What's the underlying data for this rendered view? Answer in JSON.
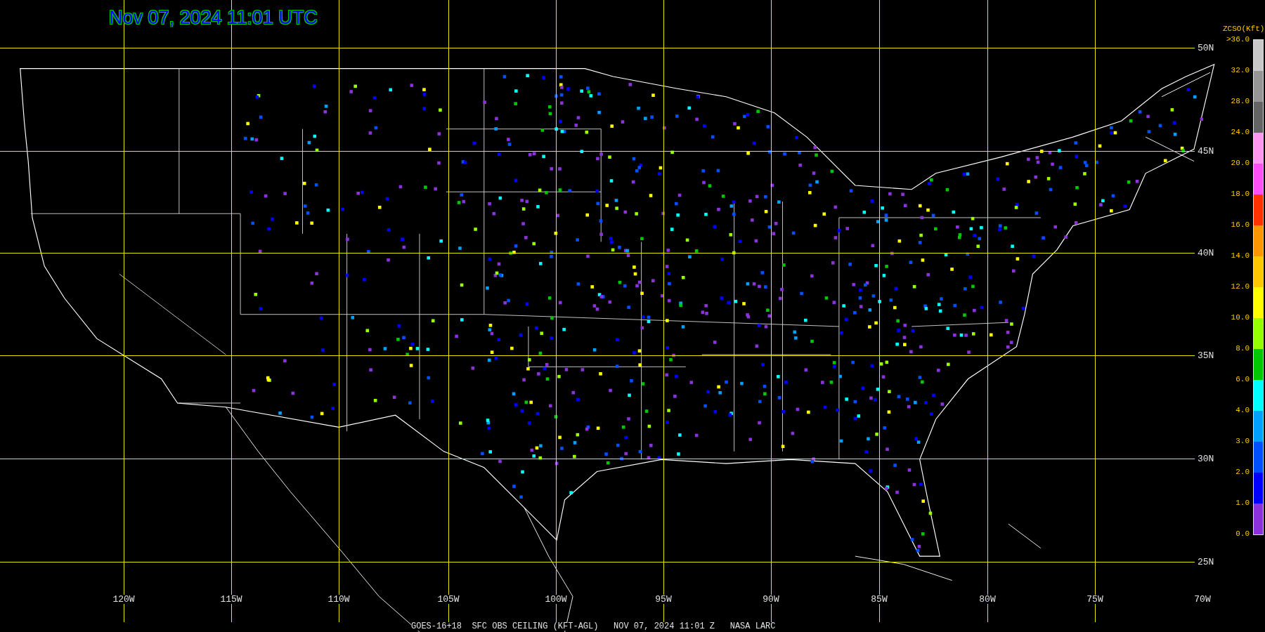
{
  "title": "Nov 07, 2024 11:01 UTC",
  "latitude_labels": [
    "50N",
    "45N",
    "40N",
    "35N",
    "30N",
    "25N"
  ],
  "longitude_labels": [
    "120W",
    "115W",
    "110W",
    "105W",
    "100W",
    "95W",
    "90W",
    "85W",
    "80W",
    "75W",
    "70W"
  ],
  "legend": {
    "title": "ZCSO(Kft)",
    "labels": [
      ">36.0",
      "32.0",
      "28.0",
      "24.0",
      "20.0",
      "18.0",
      "16.0",
      "14.0",
      "12.0",
      "10.0",
      "8.0",
      "6.0",
      "4.0",
      "3.0",
      "2.0",
      "1.0",
      "0.0"
    ],
    "segments": [
      {
        "color": "#c8c8c8"
      },
      {
        "color": "#969696"
      },
      {
        "color": "#646464"
      },
      {
        "color": "#ff96f0"
      },
      {
        "color": "#ff50f5"
      },
      {
        "color": "#ff3200"
      },
      {
        "color": "#ff9600"
      },
      {
        "color": "#ffc800"
      },
      {
        "color": "#ffff00"
      },
      {
        "color": "#96ff00"
      },
      {
        "color": "#00c800"
      },
      {
        "color": "#00ffff"
      },
      {
        "color": "#00a0ff"
      },
      {
        "color": "#0050ff"
      },
      {
        "color": "#0000ff"
      },
      {
        "color": "#8c32dc"
      }
    ]
  },
  "caption": "GOES-16+18  SFC OBS CEILING (KFT-AGL)   NOV 07, 2024 11:01 Z   NASA LARC"
}
